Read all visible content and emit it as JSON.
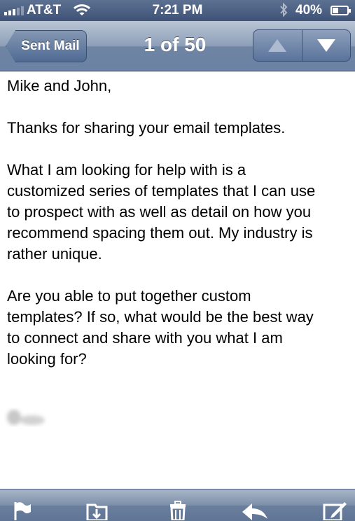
{
  "status_bar": {
    "carrier": "AT&T",
    "time": "7:21 PM",
    "battery": "40%"
  },
  "nav": {
    "back_label": "Sent Mail",
    "title": "1 of 50"
  },
  "email": {
    "paragraphs": [
      "Mike and John,",
      "Thanks for sharing your email templates.",
      "What I am looking for help with is a\ncustomized series of templates that I can use\nto prospect with as well as detail on how you\nrecommend spacing them out.  My industry is\nrather unique.",
      "Are you able to put together custom\ntemplates? If so, what would be the best way\nto connect and share with you what I am\nlooking for?"
    ]
  },
  "colors": {
    "nav_bar": "#7b8faf",
    "status_bar": "#4a5e82",
    "toolbar": "#7c8fa9"
  },
  "icons": [
    "signal-icon",
    "wifi-icon",
    "bluetooth-icon",
    "battery-icon",
    "up-arrow-icon",
    "down-arrow-icon",
    "flag-icon",
    "move-to-folder-icon",
    "trash-icon",
    "reply-icon",
    "compose-icon"
  ]
}
